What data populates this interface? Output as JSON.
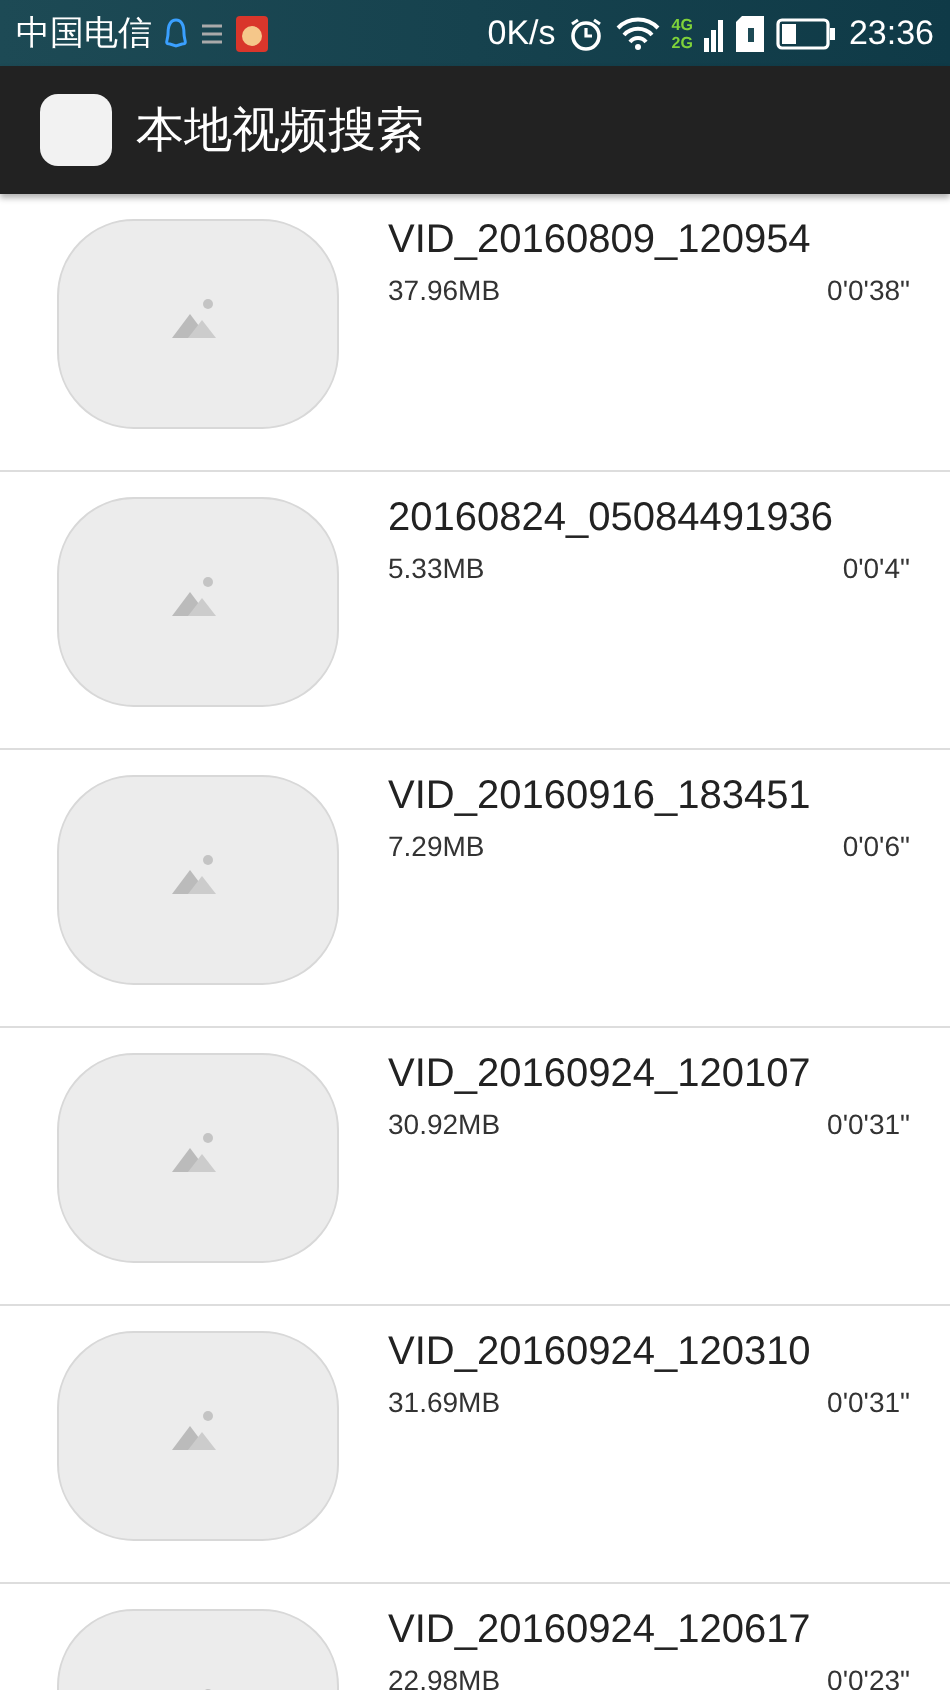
{
  "status_bar": {
    "carrier": "中国电信",
    "speed": "0K/s",
    "network_top": "4G",
    "network_bottom": "2G",
    "time": "23:36"
  },
  "app_bar": {
    "title": "本地视频搜索"
  },
  "videos": [
    {
      "name": "VID_20160809_120954",
      "size": "37.96MB",
      "duration": "0'0'38\""
    },
    {
      "name": "20160824_05084491936",
      "size": "5.33MB",
      "duration": "0'0'4\""
    },
    {
      "name": "VID_20160916_183451",
      "size": "7.29MB",
      "duration": "0'0'6\""
    },
    {
      "name": "VID_20160924_120107",
      "size": "30.92MB",
      "duration": "0'0'31\""
    },
    {
      "name": "VID_20160924_120310",
      "size": "31.69MB",
      "duration": "0'0'31\""
    },
    {
      "name": "VID_20160924_120617",
      "size": "22.98MB",
      "duration": "0'0'23\""
    }
  ]
}
